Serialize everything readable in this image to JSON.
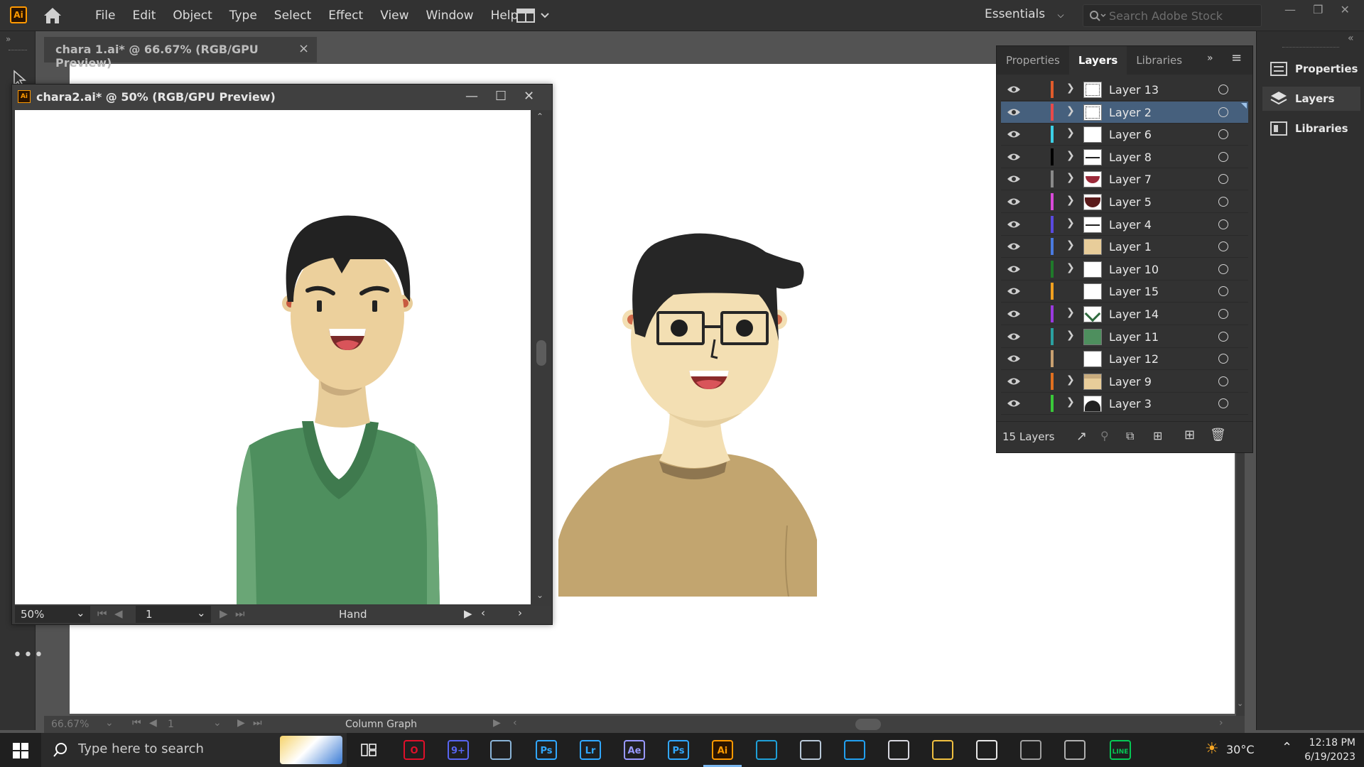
{
  "app": {
    "logo_text": "Ai",
    "menus": [
      "File",
      "Edit",
      "Object",
      "Type",
      "Select",
      "Effect",
      "View",
      "Window",
      "Help"
    ],
    "workspace": "Essentials",
    "search_placeholder": "Search Adobe Stock"
  },
  "main_doc": {
    "tab_title": "chara 1.ai* @ 66.67% (RGB/GPU Preview)",
    "close": "×",
    "zoom": "66.67%",
    "page": "1",
    "tool": "Column Graph"
  },
  "float_doc": {
    "title": "chara2.ai* @ 50% (RGB/GPU Preview)",
    "logo_text": "Ai",
    "zoom": "50%",
    "page": "1",
    "tool": "Hand"
  },
  "layers_panel": {
    "tabs": [
      "Properties",
      "Layers",
      "Libraries"
    ],
    "active_tab": "Layers",
    "layers": [
      {
        "name": "Layer 13",
        "color": "#e05b2b",
        "has_children": true,
        "selected": false,
        "thumb": "white-rect"
      },
      {
        "name": "Layer 2",
        "color": "#e84a4a",
        "has_children": true,
        "selected": true,
        "thumb": "white-rect"
      },
      {
        "name": "Layer 6",
        "color": "#3cd0e6",
        "has_children": true,
        "selected": false,
        "thumb": "white"
      },
      {
        "name": "Layer 8",
        "color": "#000000",
        "has_children": true,
        "selected": false,
        "thumb": "lines"
      },
      {
        "name": "Layer 7",
        "color": "#8a8a8a",
        "has_children": true,
        "selected": false,
        "thumb": "mouth-red"
      },
      {
        "name": "Layer 5",
        "color": "#d94ad9",
        "has_children": true,
        "selected": false,
        "thumb": "mouth-dark"
      },
      {
        "name": "Layer 4",
        "color": "#5a4ae0",
        "has_children": true,
        "selected": false,
        "thumb": "lines"
      },
      {
        "name": "Layer 1",
        "color": "#4a7ae0",
        "has_children": true,
        "selected": false,
        "thumb": "skin"
      },
      {
        "name": "Layer 10",
        "color": "#1f7a2a",
        "has_children": true,
        "selected": false,
        "thumb": "white"
      },
      {
        "name": "Layer 15",
        "color": "#f0a020",
        "has_children": false,
        "selected": false,
        "thumb": "white"
      },
      {
        "name": "Layer 14",
        "color": "#9a3ae0",
        "has_children": true,
        "selected": false,
        "thumb": "collar-green"
      },
      {
        "name": "Layer 11",
        "color": "#2aa0a0",
        "has_children": true,
        "selected": false,
        "thumb": "green"
      },
      {
        "name": "Layer 12",
        "color": "#c8a070",
        "has_children": false,
        "selected": false,
        "thumb": "white"
      },
      {
        "name": "Layer 9",
        "color": "#e07020",
        "has_children": true,
        "selected": false,
        "thumb": "skin-shadow"
      },
      {
        "name": "Layer 3",
        "color": "#3ac83a",
        "has_children": true,
        "selected": false,
        "thumb": "hair"
      }
    ],
    "count_label": "15 Layers"
  },
  "right_dock": {
    "items": [
      "Properties",
      "Layers",
      "Libraries"
    ],
    "active": "Layers"
  },
  "taskbar": {
    "search_placeholder": "Type here to search",
    "apps": [
      {
        "name": "opera",
        "label": "O",
        "color": "#e0102a"
      },
      {
        "name": "discord",
        "label": "9+",
        "color": "#5865f2"
      },
      {
        "name": "photos",
        "label": "",
        "color": "#8ab4d8"
      },
      {
        "name": "photoshop-1",
        "label": "Ps",
        "color": "#31a8ff"
      },
      {
        "name": "lightroom",
        "label": "Lr",
        "color": "#31a8ff"
      },
      {
        "name": "after-effects",
        "label": "Ae",
        "color": "#9999ff"
      },
      {
        "name": "photoshop-2",
        "label": "Ps",
        "color": "#31a8ff"
      },
      {
        "name": "illustrator",
        "label": "Ai",
        "color": "#ff9a00"
      },
      {
        "name": "edge",
        "label": "",
        "color": "#1fa0d8"
      },
      {
        "name": "steam",
        "label": "",
        "color": "#b8c8d8"
      },
      {
        "name": "vscode",
        "label": "",
        "color": "#22a0f0"
      },
      {
        "name": "obs",
        "label": "",
        "color": "#d8d8e0"
      },
      {
        "name": "file-explorer",
        "label": "",
        "color": "#f0c040"
      },
      {
        "name": "whatsapp",
        "label": "",
        "color": "#e8e8e8"
      },
      {
        "name": "app-gray-1",
        "label": "",
        "color": "#a0a0a0"
      },
      {
        "name": "app-gray-2",
        "label": "",
        "color": "#b0b0b0"
      },
      {
        "name": "line",
        "label": "LINE",
        "color": "#06c755"
      }
    ],
    "temperature": "30°C",
    "time": "12:18 PM",
    "date": "6/19/2023"
  }
}
